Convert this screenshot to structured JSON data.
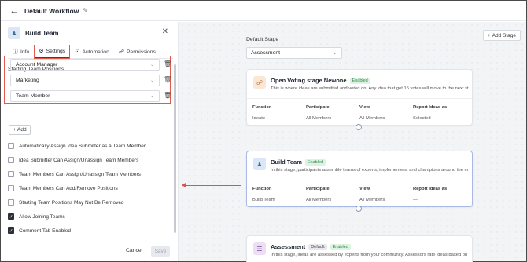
{
  "header": {
    "title": "Default Workflow",
    "back_icon": "arrow-left-icon",
    "edit_icon": "pencil-icon"
  },
  "panel": {
    "title": "Build Team",
    "tabs": [
      {
        "label": "Info",
        "icon": "info-icon"
      },
      {
        "label": "Settings",
        "icon": "gear-icon"
      },
      {
        "label": "Automation",
        "icon": "automation-icon"
      },
      {
        "label": "Permissions",
        "icon": "permissions-icon"
      }
    ],
    "starting_positions_label": "Starting Team Positions",
    "positions": [
      "Account Manager",
      "Marketing",
      "Team Member"
    ],
    "add_label": "Add",
    "options": [
      {
        "label": "Automatically Assign Idea Submitter as a Team Member",
        "checked": false
      },
      {
        "label": "Idea Submitter Can Assign/Unassign Team Members",
        "checked": false
      },
      {
        "label": "Team Members Can Assign/Unassign Team Members",
        "checked": false
      },
      {
        "label": "Team Members Can Add/Remove Positions",
        "checked": false
      },
      {
        "label": "Starting Team Positions May Not Be Removed",
        "checked": false
      },
      {
        "label": "Allow Joining Teams",
        "checked": true
      },
      {
        "label": "Comment Tab Enabled",
        "checked": true
      }
    ],
    "cancel_label": "Cancel",
    "save_label": "Save"
  },
  "canvas": {
    "add_stage_label": "Add Stage",
    "default_stage_label": "Default Stage",
    "default_stage_value": "Assessment",
    "column_headers": [
      "Function",
      "Participate",
      "View",
      "Report Ideas as"
    ],
    "stages": [
      {
        "title": "Open Voting stage Newone",
        "badges": [
          "Enabled"
        ],
        "description": "This is where ideas are submitted and voted on. Any idea that get 15 votes will move to the next st...",
        "values": [
          "Ideate",
          "All Members",
          "All Members",
          "Selected"
        ],
        "icon": "voting-icon"
      },
      {
        "title": "Build Team",
        "badges": [
          "Enabled"
        ],
        "description": "In this stage, participants assemble teams of experts, implementers, and champions around the m...",
        "values": [
          "Build Team",
          "All Members",
          "All Members",
          "—"
        ],
        "icon": "team-icon"
      },
      {
        "title": "Assessment",
        "badges": [
          "Default",
          "Enabled"
        ],
        "description": "In this stage, ideas are assessed by experts from your community. Assessors rate ideas based on a...",
        "values": [],
        "icon": "assessment-icon"
      }
    ]
  },
  "colors": {
    "accent_red": "#e05a50",
    "enabled_green": "#2f8a4b",
    "selected_border": "#a9b8e6"
  }
}
